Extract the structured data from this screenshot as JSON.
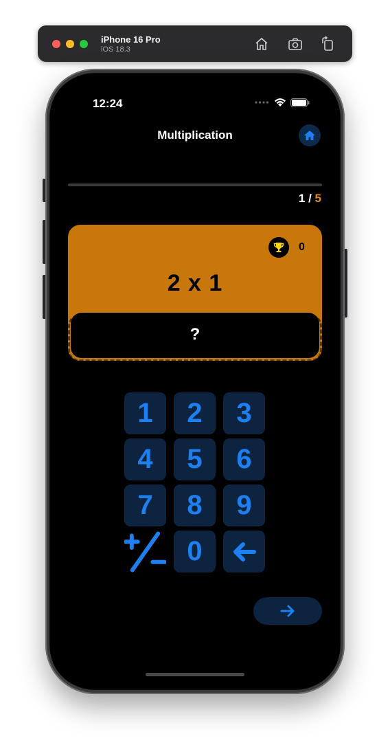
{
  "simulator": {
    "device_name": "iPhone 16 Pro",
    "os_version": "iOS 18.3",
    "buttons": [
      "home-icon",
      "screenshot-icon",
      "rotate-icon"
    ]
  },
  "status_bar": {
    "time": "12:24",
    "icons": [
      "signal-dots-icon",
      "wifi-icon",
      "battery-icon"
    ]
  },
  "nav": {
    "title": "Multiplication",
    "home_button_icon": "house-icon"
  },
  "progress": {
    "current": "1",
    "separator": " / ",
    "total": "5",
    "fraction": 0.0
  },
  "question_card": {
    "score_icon": "trophy-icon",
    "score": "0",
    "question": "2 x 1",
    "answer": "?"
  },
  "keypad": {
    "keys": [
      {
        "label": "1"
      },
      {
        "label": "2"
      },
      {
        "label": "3"
      },
      {
        "label": "4"
      },
      {
        "label": "5"
      },
      {
        "label": "6"
      },
      {
        "label": "7"
      },
      {
        "label": "8"
      },
      {
        "label": "9"
      },
      {
        "label": "",
        "icon": "plus-minus-icon"
      },
      {
        "label": "0"
      },
      {
        "label": "",
        "icon": "backspace-arrow-icon"
      }
    ]
  },
  "next_button": {
    "icon": "arrow-right-icon"
  },
  "colors": {
    "accent_orange": "#c8780a",
    "accent_blue": "#1e7ff0",
    "key_bg": "#0d2440",
    "background": "#000000"
  }
}
